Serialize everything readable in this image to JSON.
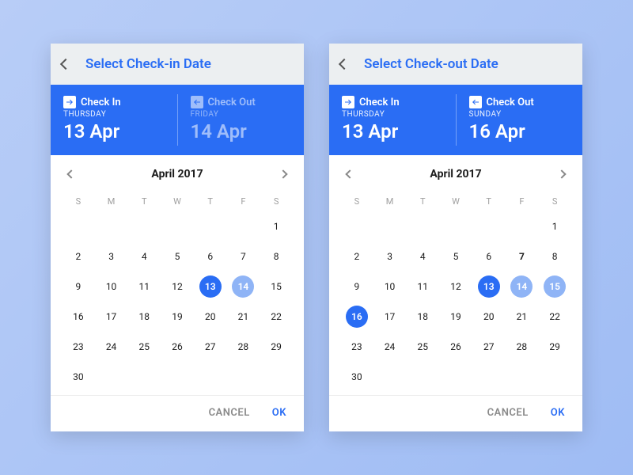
{
  "weekdays": [
    "S",
    "M",
    "T",
    "W",
    "T",
    "F",
    "S"
  ],
  "actions": {
    "cancel": "CANCEL",
    "ok": "OK"
  },
  "panels": [
    {
      "title": "Select Check-in Date",
      "month_label": "April 2017",
      "checkin": {
        "label": "Check In",
        "weekday": "THURSDAY",
        "date": "13 Apr",
        "active": true
      },
      "checkout": {
        "label": "Check Out",
        "weekday": "FRIDAY",
        "date": "14 Apr",
        "active": false
      },
      "first_weekday_index": 6,
      "days_in_month": 30,
      "bold_days": [],
      "selected_days": [
        13
      ],
      "range_days": [
        14
      ]
    },
    {
      "title": "Select Check-out Date",
      "month_label": "April 2017",
      "checkin": {
        "label": "Check In",
        "weekday": "THURSDAY",
        "date": "13 Apr",
        "active": true
      },
      "checkout": {
        "label": "Check Out",
        "weekday": "SUNDAY",
        "date": "16 Apr",
        "active": true
      },
      "first_weekday_index": 6,
      "days_in_month": 30,
      "bold_days": [
        7
      ],
      "selected_days": [
        13,
        16
      ],
      "range_days": [
        14,
        15
      ]
    }
  ]
}
